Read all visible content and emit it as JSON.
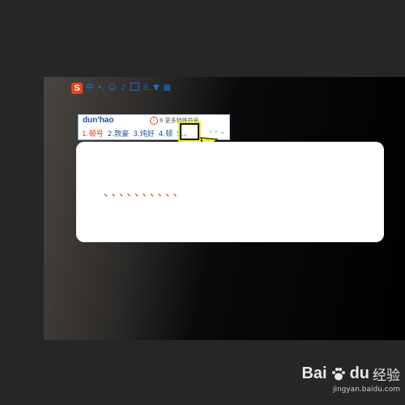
{
  "ime": {
    "logo": "S",
    "toolbar": {
      "lang": "中",
      "punct": "•,",
      "emoji_icon": "☺",
      "mic_icon": "🎤",
      "keyboard_icon": "keyboard-icon",
      "person_icon": "person-icon",
      "skin_icon": "shirt-icon",
      "grid_icon": "grid-icon"
    },
    "pinyin": "dun'hao",
    "hint_badge": "①",
    "hint_text": "6 更多特殊符号",
    "candidates": [
      {
        "label": "1.顿号"
      },
      {
        "label": "2.敦豪"
      },
      {
        "label": "3.炖好"
      },
      {
        "label": "4.顿"
      },
      {
        "label": "5.、"
      }
    ],
    "nav_prev": "‹",
    "nav_next": "›",
    "nav_more": "⌄"
  },
  "editor": {
    "content": "、、、、、、、、、、"
  },
  "colors": {
    "highlight": "#f2e81b",
    "brand": "#e8461e",
    "candidate_text": "#1f4f96",
    "first_candidate": "#e23b1a"
  },
  "watermark": {
    "brand": "Bai",
    "brand2": "du",
    "cn": "经验",
    "url": "jingyan.baidu.com"
  }
}
